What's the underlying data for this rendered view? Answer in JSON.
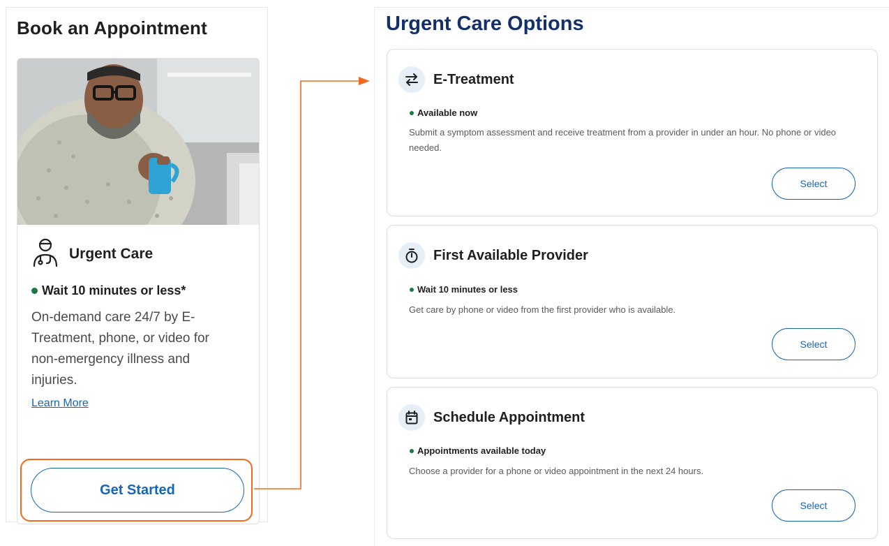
{
  "left": {
    "title": "Book an Appointment",
    "card": {
      "icon": "doctor-icon",
      "title": "Urgent Care",
      "wait": "Wait 10 minutes or less*",
      "description": "On-demand care 24/7 by E-Treatment, phone, or video for non-emergency illness and injuries.",
      "learn_more": "Learn More",
      "cta": "Get Started"
    }
  },
  "right": {
    "title": "Urgent Care Options",
    "options": [
      {
        "icon": "swap-arrows-icon",
        "title": "E-Treatment",
        "status": "Available now",
        "description": "Submit a symptom assessment and receive treatment from a provider in under an hour. No phone or video needed.",
        "button": "Select"
      },
      {
        "icon": "stopwatch-icon",
        "title": "First Available Provider",
        "status": "Wait 10 minutes or less",
        "description": "Get care by phone or video from the first provider who is available.",
        "button": "Select"
      },
      {
        "icon": "calendar-icon",
        "title": "Schedule Appointment",
        "status": "Appointments available today",
        "description": "Choose a provider for a phone or video appointment in the next 24 hours.",
        "button": "Select"
      }
    ]
  },
  "colors": {
    "accent_blue": "#1466b8",
    "heading_navy": "#14306b",
    "status_green": "#1b7a43",
    "highlight_orange": "#f26a1b"
  }
}
